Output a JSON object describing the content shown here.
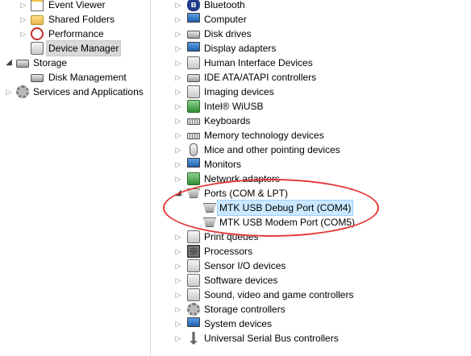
{
  "left_tree": {
    "items": [
      {
        "label": "Event Viewer",
        "icon": "event-viewer-icon",
        "expandable": true
      },
      {
        "label": "Shared Folders",
        "icon": "shared-folders-icon",
        "expandable": true
      },
      {
        "label": "Performance",
        "icon": "performance-icon",
        "expandable": true
      },
      {
        "label": "Device Manager",
        "icon": "device-manager-icon",
        "expandable": false,
        "selected": true
      },
      {
        "label": "Storage",
        "icon": "storage-icon",
        "expanded": true
      },
      {
        "label": "Disk Management",
        "icon": "disk-management-icon",
        "expandable": false
      },
      {
        "label": "Services and Applications",
        "icon": "services-icon",
        "expandable": true
      }
    ]
  },
  "device_tree": {
    "categories": [
      {
        "label": "Bluetooth",
        "icon": "bluetooth-icon"
      },
      {
        "label": "Computer",
        "icon": "computer-icon"
      },
      {
        "label": "Disk drives",
        "icon": "disk-drive-icon"
      },
      {
        "label": "Display adapters",
        "icon": "display-adapter-icon"
      },
      {
        "label": "Human Interface Devices",
        "icon": "hid-icon"
      },
      {
        "label": "IDE ATA/ATAPI controllers",
        "icon": "ide-controller-icon"
      },
      {
        "label": "Imaging devices",
        "icon": "imaging-device-icon"
      },
      {
        "label": "Intel® WiUSB",
        "icon": "wiusb-icon"
      },
      {
        "label": "Keyboards",
        "icon": "keyboard-icon"
      },
      {
        "label": "Memory technology devices",
        "icon": "memory-device-icon"
      },
      {
        "label": "Mice and other pointing devices",
        "icon": "mouse-icon"
      },
      {
        "label": "Monitors",
        "icon": "monitor-icon"
      },
      {
        "label": "Network adapters",
        "icon": "network-adapter-icon"
      },
      {
        "label": "Ports (COM & LPT)",
        "icon": "port-icon",
        "expanded": true,
        "children": [
          {
            "label": "MTK USB Debug Port (COM4)",
            "icon": "port-icon",
            "highlighted": true
          },
          {
            "label": "MTK USB Modem Port (COM5)",
            "icon": "port-icon"
          }
        ]
      },
      {
        "label": "Print queues",
        "icon": "printer-icon"
      },
      {
        "label": "Processors",
        "icon": "processor-icon"
      },
      {
        "label": "Sensor I/O devices",
        "icon": "sensor-icon"
      },
      {
        "label": "Software devices",
        "icon": "software-device-icon"
      },
      {
        "label": "Sound, video and game controllers",
        "icon": "sound-icon"
      },
      {
        "label": "Storage controllers",
        "icon": "storage-controller-icon"
      },
      {
        "label": "System devices",
        "icon": "system-device-icon"
      },
      {
        "label": "Universal Serial Bus controllers",
        "icon": "usb-icon"
      }
    ]
  },
  "colors": {
    "annotation": "#e53935",
    "selection": "#cce8ff"
  }
}
